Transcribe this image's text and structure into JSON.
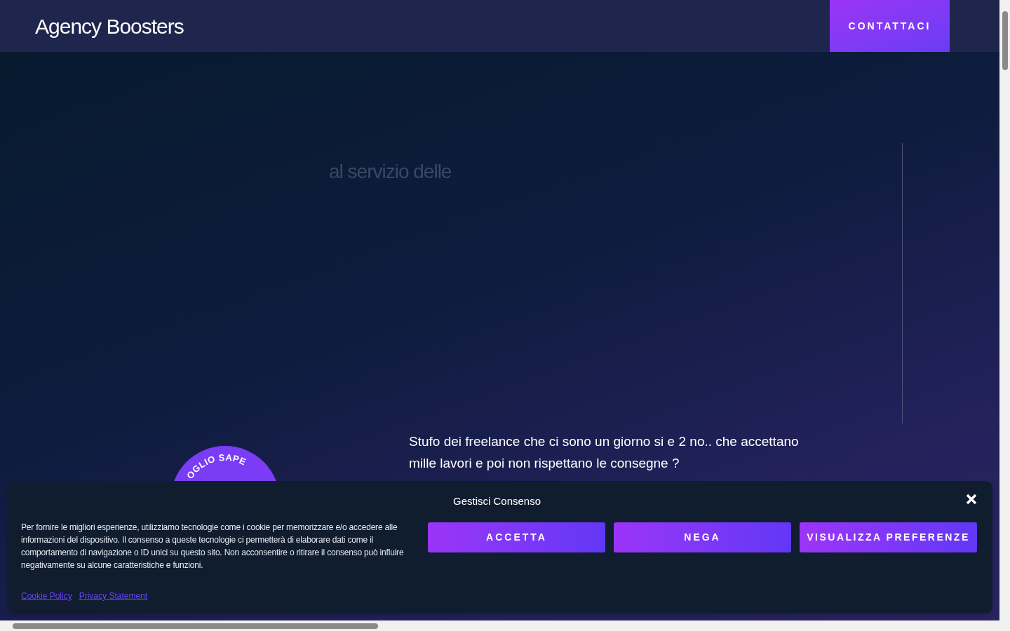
{
  "header": {
    "logo": "Agency Boosters",
    "cta": "CONTATTACI"
  },
  "hero": {
    "faded_heading": "al servizio delle",
    "badge_text": "OGLIO   SAPE",
    "lead": "Stufo dei freelance che ci sono un giorno si e 2 no.. che accettano mille lavori e poi non rispettano le consegne ?"
  },
  "cookie_banner": {
    "title": "Gestisci Consenso",
    "body": "Per fornire le migliori esperienze, utilizziamo tecnologie come i cookie per memorizzare e/o accedere alle informazioni del dispositivo. Il consenso a queste tecnologie ci permetterà di elaborare dati come il comportamento di navigazione o ID unici su questo sito. Non acconsentire o ritirare il consenso può influire negativamente su alcune caratteristiche e funzioni.",
    "buttons": [
      "ACCETTA",
      "NEGA",
      "VISUALIZZA PREFERENZE"
    ],
    "links": [
      "Cookie Policy",
      "Privacy Statement"
    ]
  }
}
